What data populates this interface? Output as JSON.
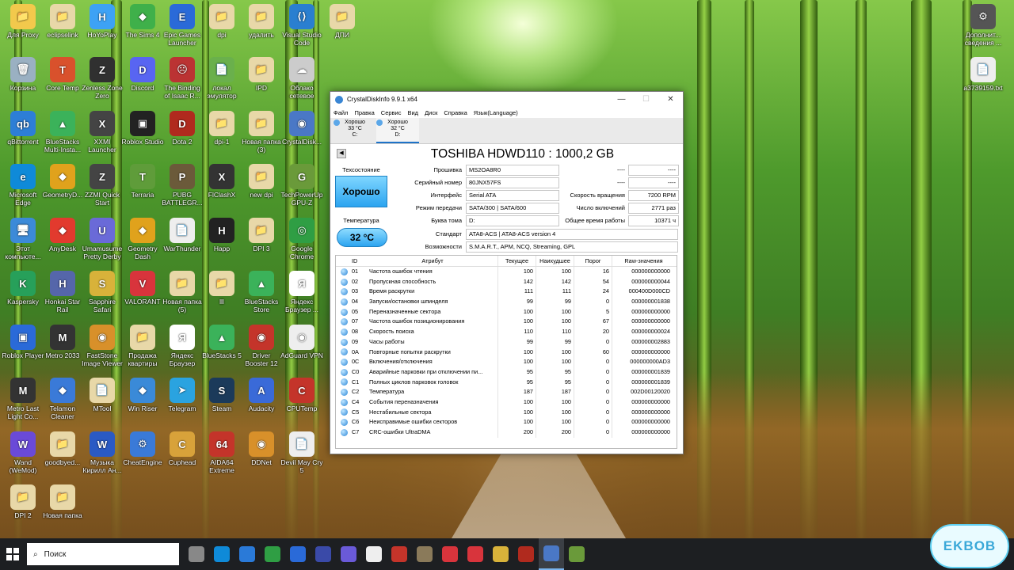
{
  "desktop": {
    "icons": [
      {
        "label": "Для Proxy",
        "color": "#f2c94c",
        "glyph": "📁"
      },
      {
        "label": "eclipselink",
        "color": "#e8d8a8",
        "glyph": "📁"
      },
      {
        "label": "HoYoPlay",
        "color": "#3da2f5",
        "glyph": "H"
      },
      {
        "label": "The Sims 4",
        "color": "#3fb04a",
        "glyph": "◆"
      },
      {
        "label": "Epic Games Launcher",
        "color": "#2a6ad8",
        "glyph": "E"
      },
      {
        "label": "dpi",
        "color": "#e8d8a8",
        "glyph": "📁"
      },
      {
        "label": "удалить",
        "color": "#e8d8a8",
        "glyph": "📁"
      },
      {
        "label": "Visual Studio Code",
        "color": "#2a7fd0",
        "glyph": "⟨⟩"
      },
      {
        "label": "ДПИ",
        "color": "#e8d8a8",
        "glyph": "📁"
      },
      {
        "label": "Корзина",
        "color": "#9ab0c2",
        "glyph": "🗑"
      },
      {
        "label": "Core Temp",
        "color": "#d9512c",
        "glyph": "T"
      },
      {
        "label": "Zenless Zone Zero",
        "color": "#303030",
        "glyph": "Z"
      },
      {
        "label": "Discord",
        "color": "#5865f2",
        "glyph": "D"
      },
      {
        "label": "The Binding of Isaac R...",
        "color": "#b33",
        "glyph": "☹"
      },
      {
        "label": "локал эмулятор",
        "color": "#6ab04c",
        "glyph": "📄"
      },
      {
        "label": "IPD",
        "color": "#e8d8a8",
        "glyph": "📁"
      },
      {
        "label": "Облако сетевое",
        "color": "#ccc",
        "glyph": "☁"
      },
      {
        "label": "qBittorrent",
        "color": "#2d7ed6",
        "glyph": "qb"
      },
      {
        "label": "BlueStacks Multi-Insta...",
        "color": "#3bb25a",
        "glyph": "▲"
      },
      {
        "label": "XXMI Launcher",
        "color": "#444",
        "glyph": "X"
      },
      {
        "label": "Roblox Studio",
        "color": "#222",
        "glyph": "▣"
      },
      {
        "label": "Dota 2",
        "color": "#b02a1e",
        "glyph": "D"
      },
      {
        "label": "dpi-1",
        "color": "#e8d8a8",
        "glyph": "📁"
      },
      {
        "label": "Новая папка (3)",
        "color": "#e8d8a8",
        "glyph": "📁"
      },
      {
        "label": "CrystalDisk...",
        "color": "#4a78c6",
        "glyph": "◉"
      },
      {
        "label": "Microsoft Edge",
        "color": "#0f8ad8",
        "glyph": "e"
      },
      {
        "label": "GeometryD...",
        "color": "#e0a21c",
        "glyph": "◆"
      },
      {
        "label": "ZZMI Quick Start",
        "color": "#444",
        "glyph": "Z"
      },
      {
        "label": "Terraria",
        "color": "#5f9c3a",
        "glyph": "T"
      },
      {
        "label": "PUBG BATTLEGR...",
        "color": "#6b5a3a",
        "glyph": "P"
      },
      {
        "label": "FlClashX",
        "color": "#333",
        "glyph": "X"
      },
      {
        "label": "new dpi",
        "color": "#e8d8a8",
        "glyph": "📁"
      },
      {
        "label": "TechPowerUp GPU-Z",
        "color": "#6a9a3a",
        "glyph": "G"
      },
      {
        "label": "Этот компьюте...",
        "color": "#3c8ad8",
        "glyph": "🖥"
      },
      {
        "label": "AnyDesk",
        "color": "#e23a2e",
        "glyph": "◆"
      },
      {
        "label": "Umamusume Pretty Derby",
        "color": "#6a6ad8",
        "glyph": "U"
      },
      {
        "label": "Geometry Dash",
        "color": "#e0a21c",
        "glyph": "◆"
      },
      {
        "label": "WarThunder",
        "color": "#eee",
        "glyph": "📄"
      },
      {
        "label": "Happ",
        "color": "#222",
        "glyph": "H"
      },
      {
        "label": "DPI 3",
        "color": "#e8d8a8",
        "glyph": "📁"
      },
      {
        "label": "Google Chrome",
        "color": "#2f9e44",
        "glyph": "◎"
      },
      {
        "label": "Kaspersky",
        "color": "#27a05a",
        "glyph": "K"
      },
      {
        "label": "Honkai Star Rail",
        "color": "#5566aa",
        "glyph": "H"
      },
      {
        "label": "Sapphire Safari",
        "color": "#d8b23a",
        "glyph": "S"
      },
      {
        "label": "VALORANT",
        "color": "#d8343c",
        "glyph": "V"
      },
      {
        "label": "Новая папка (5)",
        "color": "#e8d8a8",
        "glyph": "📁"
      },
      {
        "label": "lll",
        "color": "#e8d8a8",
        "glyph": "📁"
      },
      {
        "label": "BlueStacks Store",
        "color": "#3bb25a",
        "glyph": "▲"
      },
      {
        "label": "Яндекс Браузер ...",
        "color": "#fff",
        "glyph": "Я"
      },
      {
        "label": "Roblox Player",
        "color": "#2a6ad8",
        "glyph": "▣"
      },
      {
        "label": "Metro 2033",
        "color": "#333",
        "glyph": "M"
      },
      {
        "label": "FastStone Image Viewer",
        "color": "#d8902a",
        "glyph": "◉"
      },
      {
        "label": "Продажа квартиры",
        "color": "#e8d8a8",
        "glyph": "📁"
      },
      {
        "label": "Яндекс Браузер",
        "color": "#fff",
        "glyph": "Я"
      },
      {
        "label": "BlueStacks 5",
        "color": "#3bb25a",
        "glyph": "▲"
      },
      {
        "label": "Driver Booster 12",
        "color": "#c4342a",
        "glyph": "◉"
      },
      {
        "label": "AdGuard VPN",
        "color": "#eee",
        "glyph": "◉"
      },
      {
        "label": "Metro Last Light Co...",
        "color": "#333",
        "glyph": "M"
      },
      {
        "label": "Telamon Cleaner",
        "color": "#3a7ad8",
        "glyph": "◆"
      },
      {
        "label": "MTool",
        "color": "#e8d8a8",
        "glyph": "📄"
      },
      {
        "label": "Win Riser",
        "color": "#3a8ad8",
        "glyph": "◆"
      },
      {
        "label": "Telegram",
        "color": "#2aa3e0",
        "glyph": "➤"
      },
      {
        "label": "Steam",
        "color": "#1b3a5a",
        "glyph": "S"
      },
      {
        "label": "Audacity",
        "color": "#3a6ad8",
        "glyph": "A"
      },
      {
        "label": "CPUTemp",
        "color": "#c4342a",
        "glyph": "C"
      },
      {
        "label": "Wand (WeMod)",
        "color": "#6a4ad8",
        "glyph": "W"
      },
      {
        "label": "goodbyed...",
        "color": "#e8d8a8",
        "glyph": "📁"
      },
      {
        "label": "Музыка Кирилл Ан...",
        "color": "#2a5ac4",
        "glyph": "W"
      },
      {
        "label": "CheatEngine",
        "color": "#3a7ad8",
        "glyph": "⚙"
      },
      {
        "label": "Cuphead",
        "color": "#d8a23a",
        "glyph": "C"
      },
      {
        "label": "AIDA64 Extreme",
        "color": "#c4342a",
        "glyph": "64"
      },
      {
        "label": "DDNet",
        "color": "#d8902a",
        "glyph": "◉"
      },
      {
        "label": "Devil May Cry 5",
        "color": "#eee",
        "glyph": "📄"
      },
      {
        "label": "DPI 2",
        "color": "#e8d8a8",
        "glyph": "📁"
      },
      {
        "label": "Новая папка",
        "color": "#e8d8a8",
        "glyph": "📁"
      },
      {
        "label": "Дополнит... сведения ...",
        "color": "#555",
        "glyph": "⚙"
      },
      {
        "label": "a3739159.txt",
        "color": "#eee",
        "glyph": "📄"
      }
    ]
  },
  "window": {
    "title": "CrystalDiskInfo 9.9.1 x64",
    "menu": [
      "Файл",
      "Правка",
      "Сервис",
      "Вид",
      "Диск",
      "Справка",
      "Язык(Language)"
    ],
    "disks": [
      {
        "status": "Хорошо",
        "temp": "33 °C",
        "letter": "C:"
      },
      {
        "status": "Хорошо",
        "temp": "32 °C",
        "letter": "D:"
      }
    ],
    "drive_title": "TOSHIBA HDWD110 : 1000,2 GB",
    "health_label": "Техсостояние",
    "health_value": "Хорошо",
    "temp_label": "Температура",
    "temp_value": "32 °C",
    "fields": {
      "firmware_label": "Прошивка",
      "firmware": "MS2OA8R0",
      "serial_label": "Серийный номер",
      "serial": "80JNX57FS",
      "interface_label": "Интерфейс",
      "interface": "Serial ATA",
      "transfer_label": "Режим передачи",
      "transfer": "SATA/300 | SATA/600",
      "letter_label": "Буква тома",
      "letter": "D:",
      "standard_label": "Стандарт",
      "standard": "ATA8-ACS | ATA8-ACS version 4",
      "features_label": "Возможности",
      "features": "S.M.A.R.T., APM, NCQ, Streaming, GPL",
      "blank1_label": "----",
      "blank1": "----",
      "blank2_label": "----",
      "blank2": "----",
      "rpm_label": "Скорость вращения",
      "rpm": "7200 RPM",
      "power_count_label": "Число включений",
      "power_count": "2771 раз",
      "power_hours_label": "Общее время работы",
      "power_hours": "10371 ч"
    },
    "table_headers": [
      "ID",
      "Атрибут",
      "Текущее",
      "Наихудшее",
      "Порог",
      "Raw-значения"
    ],
    "smart": [
      [
        "01",
        "Частота ошибок чтения",
        "100",
        "100",
        "16",
        "000000000000"
      ],
      [
        "02",
        "Пропускная способность",
        "142",
        "142",
        "54",
        "000000000044"
      ],
      [
        "03",
        "Время раскрутки",
        "111",
        "111",
        "24",
        "000400D000CD"
      ],
      [
        "04",
        "Запуски/остановки шпинделя",
        "99",
        "99",
        "0",
        "000000001838"
      ],
      [
        "05",
        "Переназначенные сектора",
        "100",
        "100",
        "5",
        "000000000000"
      ],
      [
        "07",
        "Частота ошибок позиционирования",
        "100",
        "100",
        "67",
        "000000000000"
      ],
      [
        "08",
        "Скорость поиска",
        "110",
        "110",
        "20",
        "000000000024"
      ],
      [
        "09",
        "Часы работы",
        "99",
        "99",
        "0",
        "000000002883"
      ],
      [
        "0A",
        "Повторные попытки раскрутки",
        "100",
        "100",
        "60",
        "000000000000"
      ],
      [
        "0C",
        "Включения/отключения",
        "100",
        "100",
        "0",
        "000000000AD3"
      ],
      [
        "C0",
        "Аварийные парковки при отключении пи...",
        "95",
        "95",
        "0",
        "000000001839"
      ],
      [
        "C1",
        "Полных циклов парковок головок",
        "95",
        "95",
        "0",
        "000000001839"
      ],
      [
        "C2",
        "Температура",
        "187",
        "187",
        "0",
        "002D00120020"
      ],
      [
        "C4",
        "События переназначения",
        "100",
        "100",
        "0",
        "000000000000"
      ],
      [
        "C5",
        "Нестабильные сектора",
        "100",
        "100",
        "0",
        "000000000000"
      ],
      [
        "C6",
        "Неисправимые ошибки секторов",
        "100",
        "100",
        "0",
        "000000000000"
      ],
      [
        "C7",
        "CRC-ошибки UltraDMA",
        "200",
        "200",
        "0",
        "000000000000"
      ]
    ]
  },
  "taskbar": {
    "search_placeholder": "Поиск",
    "apps": [
      {
        "name": "task-view",
        "color": "#888"
      },
      {
        "name": "edge",
        "color": "#0f8ad8"
      },
      {
        "name": "store",
        "color": "#2a7ad8"
      },
      {
        "name": "chrome",
        "color": "#2f9e44"
      },
      {
        "name": "mail",
        "color": "#2a6ad8"
      },
      {
        "name": "yandex",
        "color": "#3a4aa8"
      },
      {
        "name": "game",
        "color": "#6a5ad8"
      },
      {
        "name": "file",
        "color": "#eee"
      },
      {
        "name": "record",
        "color": "#c4342a"
      },
      {
        "name": "box",
        "color": "#8a7a5a"
      },
      {
        "name": "wps",
        "color": "#d8343c"
      },
      {
        "name": "yandex-browser",
        "color": "#d8343c"
      },
      {
        "name": "sapphire",
        "color": "#d8b23a"
      },
      {
        "name": "metro",
        "color": "#b02a1e"
      },
      {
        "name": "crystaldisk",
        "color": "#4a78c6",
        "active": true
      },
      {
        "name": "folder",
        "color": "#6a9a3a"
      }
    ],
    "watermark": "EKBOB"
  }
}
